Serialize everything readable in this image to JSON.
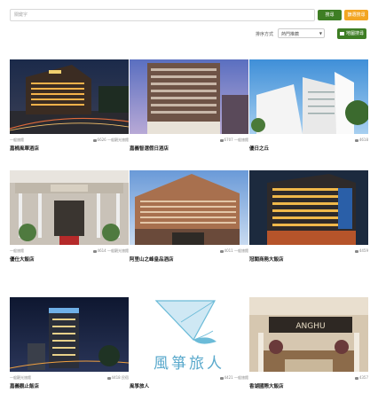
{
  "search": {
    "placeholder": "關鍵字",
    "search_label": "搜尋",
    "filter_label": "篩選搜尋"
  },
  "sort": {
    "label": "排序方式",
    "selected": "熱門推薦",
    "map_label": "地圖搜尋"
  },
  "hotels": [
    {
      "category": "一般旅館",
      "stat": "6626 一般觀光旅館",
      "name": "嘉楠風華酒店"
    },
    {
      "category": "",
      "stat": "6707 一般旅館",
      "name": "嘉義智選假日酒店"
    },
    {
      "category": "",
      "stat": "4618",
      "name": "優日之丘"
    },
    {
      "category": "一般旅館",
      "stat": "4614 一般觀光旅館",
      "name": "優仕大飯店"
    },
    {
      "category": "",
      "stat": "4011 一般旅館",
      "name": "阿里山之峰皇品酒店"
    },
    {
      "category": "",
      "stat": "4459",
      "name": "冠閣商務大飯店"
    },
    {
      "category": "一般觀光旅館",
      "stat": "4418 民宿",
      "name": "嘉義觀止飯店"
    },
    {
      "category": "",
      "stat": "4421 一般旅館",
      "name": "風箏旅人"
    },
    {
      "category": "",
      "stat": "4357",
      "name": "香湖國際大飯店"
    }
  ],
  "kite_logo_text": "風箏旅人",
  "colors": {
    "green": "#3e7e24",
    "orange": "#f3a623"
  }
}
